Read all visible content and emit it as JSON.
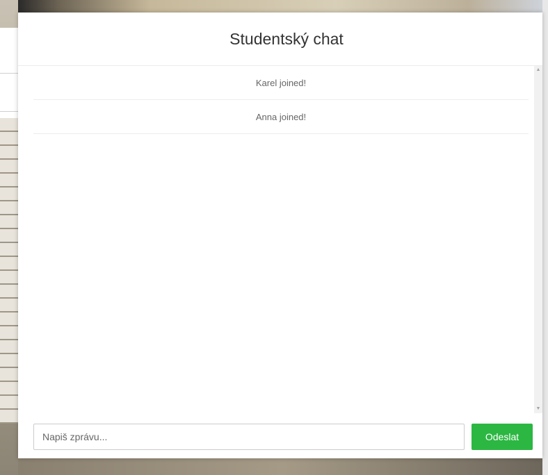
{
  "modal": {
    "title": "Studentský chat"
  },
  "messages": [
    {
      "text": "Karel joined!"
    },
    {
      "text": "Anna joined!"
    }
  ],
  "composer": {
    "placeholder": "Napiš zprávu...",
    "value": "",
    "send_label": "Odeslat"
  },
  "colors": {
    "send_button": "#2cb742",
    "title_text": "#333333",
    "message_text": "#666666"
  },
  "icons": {
    "scroll_up": "scroll-up-arrow-icon",
    "scroll_down": "scroll-down-arrow-icon"
  }
}
